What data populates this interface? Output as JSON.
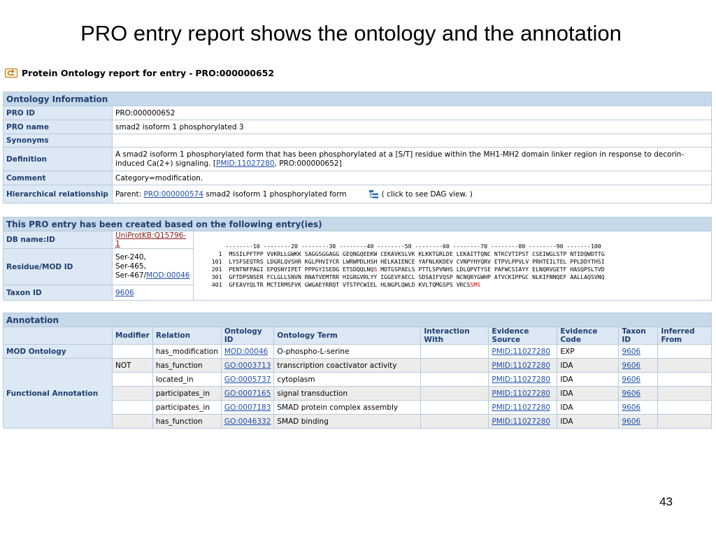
{
  "slide": {
    "title": "PRO entry report shows the ontology and the annotation",
    "page_number": "43"
  },
  "report": {
    "title_prefix": "Protein Ontology report for entry",
    "separator": "-",
    "entry_id": "PRO:000000652"
  },
  "ontology": {
    "heading": "Ontology Information",
    "rows": {
      "pro_id": {
        "label": "PRO ID",
        "value": "PRO:000000652"
      },
      "pro_name": {
        "label": "PRO name",
        "value": "smad2 isoform 1 phosphorylated 3"
      },
      "synonyms": {
        "label": "Synonyms",
        "value": ""
      },
      "definition": {
        "label": "Definition",
        "text_before": "A smad2 isoform 1 phosphorylated form that has been phosphorylated at a [S/T] residue within the MH1-MH2 domain linker region in response to decorin-induced Ca(2+) signaling. [",
        "link": "PMID:11027280",
        "text_after": ", PRO:000000652]"
      },
      "comment": {
        "label": "Comment",
        "value": "Category=modification."
      },
      "hierarchy": {
        "label": "Hierarchical relationship",
        "parent_prefix": "Parent:",
        "parent_link": "PRO:000000574",
        "parent_name": "smad2 isoform 1 phosphorylated form",
        "dag_text": "( click to see DAG view. )"
      }
    }
  },
  "basis": {
    "heading": "This PRO entry has been created based on the following entry(ies)",
    "db_label": "DB name:ID",
    "db_value": "UniProtKB:Q15796-1",
    "residue_label": "Residue/MOD ID",
    "residue_lines": [
      "Ser-240,",
      "Ser-465,"
    ],
    "residue_last_prefix": "Ser-467/",
    "residue_mod_link": "MOD:00046",
    "taxon_label": "Taxon ID",
    "taxon_value": "9606",
    "sequence": {
      "ruler": "        --------10 --------20 --------30 --------40 --------50 --------60 --------70 --------80 --------90 -------100",
      "lines": [
        "      1  MSSILPFTPP VVKRLLGWKK SAGGSGGAGG GEQNGQEEKW CEKAVKSLVK KLKKTGRLDE LEKAITTQNC NTKCVTIPST CSEIWGLSTP NTIDQWDTTG",
        "    101  LYSFSEQTRS LDGRLQVSHR KGLPHVIYCR LWRWPDLHSH HELKAIENCE YAFNLKKDEV CVNPYHYQRV ETPVLPPVLV PRHTEILTEL PPLDDYTHSI",
        "    201  PENTNFPAGI EPQSNYIPET PPPGYISEDG ETSDQQLNQ",
        "    301  GFTDPSNSER FCLGLLSNVN RNATVEMTRR HIGRGVRLYY IGGEVFAECL SDSAIFVQSP NCNQRYGWHP ATVCKIPPGC NLKIFNNQEF AALLAQSVNQ",
        "    401  GFEAVYQLTR MCTIRMSFVK GWGAEYRRQT VTSTPCWIEL HLNGPLQWLD KVLTQMGSPS VRCS"
      ],
      "line3_red": "S",
      "line3_rest": " MDTGSPAELS PTTLSPVNHS LDLQPVTYSE PAFWCSIAYY ELNQRVGETF HASQPSLTVD",
      "line5_red": "SMS"
    }
  },
  "annotation": {
    "heading": "Annotation",
    "columns": [
      "Modifier",
      "Relation",
      "Ontology ID",
      "Ontology Term",
      "Interaction With",
      "Evidence Source",
      "Evidence Code",
      "Taxon ID",
      "Inferred From"
    ],
    "mod_label": "MOD Ontology",
    "func_label": "Functional Annotation",
    "rows": [
      {
        "modifier": "",
        "relation": "has_modification",
        "ontology_id": "MOD:00046",
        "term": "O-phospho-L-serine",
        "interaction": "",
        "evidence_source": "PMID:11027280",
        "evidence_code": "EXP",
        "taxon": "9606",
        "inferred": ""
      },
      {
        "modifier": "NOT",
        "relation": "has_function",
        "ontology_id": "GO:0003713",
        "term": "transcription coactivator activity",
        "interaction": "",
        "evidence_source": "PMID:11027280",
        "evidence_code": "IDA",
        "taxon": "9606",
        "inferred": ""
      },
      {
        "modifier": "",
        "relation": "located_in",
        "ontology_id": "GO:0005737",
        "term": "cytoplasm",
        "interaction": "",
        "evidence_source": "PMID:11027280",
        "evidence_code": "IDA",
        "taxon": "9606",
        "inferred": ""
      },
      {
        "modifier": "",
        "relation": "participates_in",
        "ontology_id": "GO:0007165",
        "term": "signal transduction",
        "interaction": "",
        "evidence_source": "PMID:11027280",
        "evidence_code": "IDA",
        "taxon": "9606",
        "inferred": ""
      },
      {
        "modifier": "",
        "relation": "participates_in",
        "ontology_id": "GO:0007183",
        "term": "SMAD protein complex assembly",
        "interaction": "",
        "evidence_source": "PMID:11027280",
        "evidence_code": "IDA",
        "taxon": "9606",
        "inferred": ""
      },
      {
        "modifier": "",
        "relation": "has_function",
        "ontology_id": "GO:0046332",
        "term": "SMAD binding",
        "interaction": "",
        "evidence_source": "PMID:11027280",
        "evidence_code": "IDA",
        "taxon": "9606",
        "inferred": ""
      }
    ]
  },
  "icons": {
    "back": "back-arrow-icon",
    "dag": "tree-view-icon"
  }
}
